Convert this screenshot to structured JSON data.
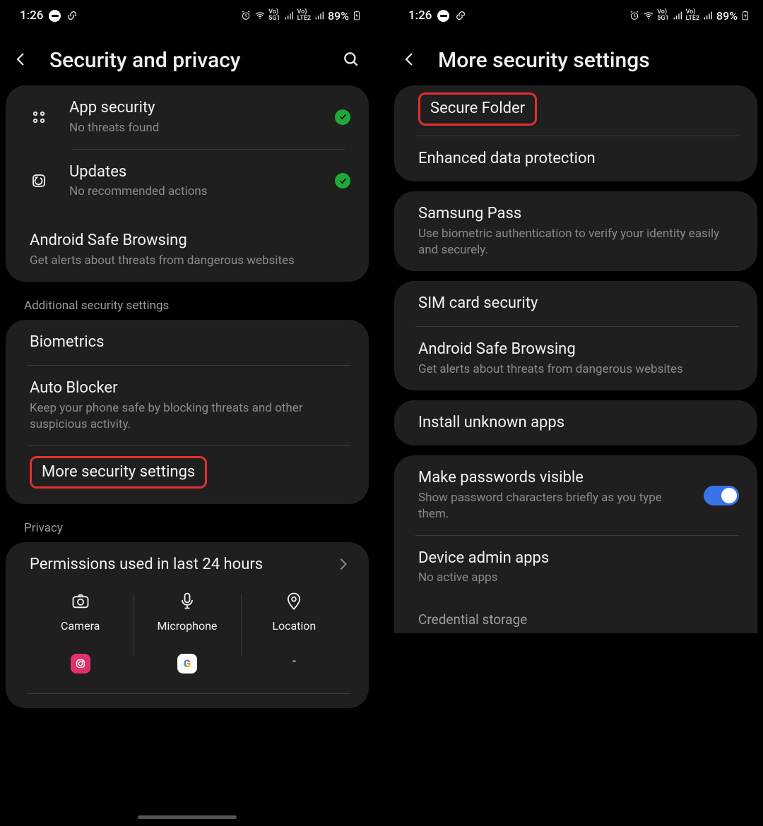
{
  "status": {
    "time": "1:26",
    "battery": "89%"
  },
  "screen_left": {
    "title": "Security and privacy",
    "card1": {
      "app_security": {
        "title": "App security",
        "sub": "No threats found"
      },
      "updates": {
        "title": "Updates",
        "sub": "No recommended actions"
      },
      "safe_browsing": {
        "title": "Android Safe Browsing",
        "sub": "Get alerts about threats from dangerous websites"
      }
    },
    "section_additional": "Additional security settings",
    "card2": {
      "biometrics": "Biometrics",
      "auto_blocker": {
        "title": "Auto Blocker",
        "sub": "Keep your phone safe by blocking threats and other suspicious activity."
      },
      "more_security": "More security settings"
    },
    "section_privacy": "Privacy",
    "permissions_title": "Permissions used in last 24 hours",
    "perm": {
      "camera": "Camera",
      "microphone": "Microphone",
      "location": "Location",
      "dash": "-"
    }
  },
  "screen_right": {
    "title": "More security settings",
    "card1": {
      "secure_folder": "Secure Folder",
      "enhanced": "Enhanced data protection"
    },
    "card2": {
      "samsung_pass": {
        "title": "Samsung Pass",
        "sub": "Use biometric authentication to verify your identity easily and securely."
      }
    },
    "card3": {
      "sim": "SIM card security",
      "safe_browsing": {
        "title": "Android Safe Browsing",
        "sub": "Get alerts about threats from dangerous websites"
      }
    },
    "card4": {
      "install_unknown": "Install unknown apps"
    },
    "card5": {
      "passwords_visible": {
        "title": "Make passwords visible",
        "sub": "Show password characters briefly as you type them."
      },
      "device_admin": {
        "title": "Device admin apps",
        "sub": "No active apps"
      },
      "credential_storage": "Credential storage"
    }
  }
}
